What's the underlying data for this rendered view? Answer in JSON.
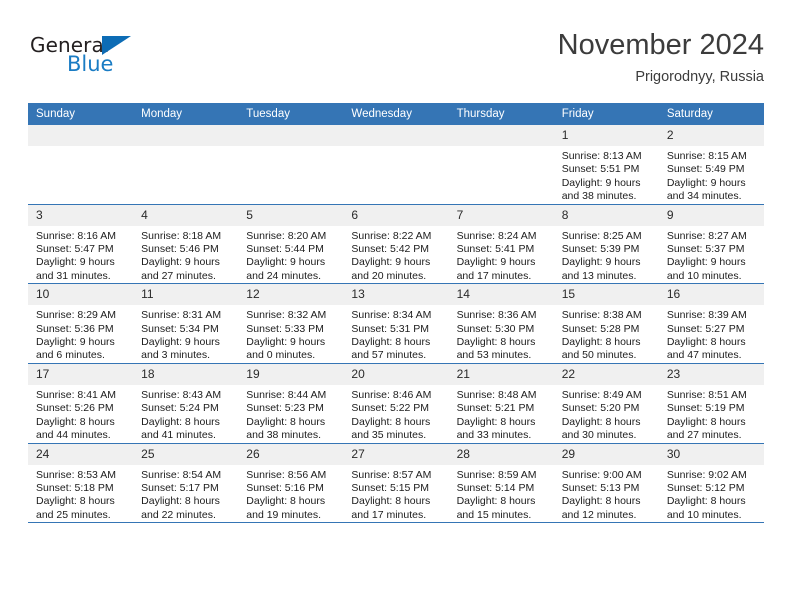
{
  "brand": {
    "word_one": "General",
    "word_two": "Blue",
    "triangle_color": "#0d6cb5",
    "blue_text_color": "#1a7cc4"
  },
  "header": {
    "title": "November 2024",
    "subtitle": "Prigorodnyy, Russia",
    "header_bg": "#3575b5",
    "header_text": "#ffffff"
  },
  "weekday_headers": [
    "Sunday",
    "Monday",
    "Tuesday",
    "Wednesday",
    "Thursday",
    "Friday",
    "Saturday"
  ],
  "labels": {
    "sunrise": "Sunrise:",
    "sunset": "Sunset:",
    "daylight": "Daylight:"
  },
  "weeks": [
    [
      {
        "day": "",
        "empty": true
      },
      {
        "day": "",
        "empty": true
      },
      {
        "day": "",
        "empty": true
      },
      {
        "day": "",
        "empty": true
      },
      {
        "day": "",
        "empty": true
      },
      {
        "day": "1",
        "sunrise": "Sunrise: 8:13 AM",
        "sunset": "Sunset: 5:51 PM",
        "daylight": "Daylight: 9 hours and 38 minutes."
      },
      {
        "day": "2",
        "sunrise": "Sunrise: 8:15 AM",
        "sunset": "Sunset: 5:49 PM",
        "daylight": "Daylight: 9 hours and 34 minutes."
      }
    ],
    [
      {
        "day": "3",
        "sunrise": "Sunrise: 8:16 AM",
        "sunset": "Sunset: 5:47 PM",
        "daylight": "Daylight: 9 hours and 31 minutes."
      },
      {
        "day": "4",
        "sunrise": "Sunrise: 8:18 AM",
        "sunset": "Sunset: 5:46 PM",
        "daylight": "Daylight: 9 hours and 27 minutes."
      },
      {
        "day": "5",
        "sunrise": "Sunrise: 8:20 AM",
        "sunset": "Sunset: 5:44 PM",
        "daylight": "Daylight: 9 hours and 24 minutes."
      },
      {
        "day": "6",
        "sunrise": "Sunrise: 8:22 AM",
        "sunset": "Sunset: 5:42 PM",
        "daylight": "Daylight: 9 hours and 20 minutes."
      },
      {
        "day": "7",
        "sunrise": "Sunrise: 8:24 AM",
        "sunset": "Sunset: 5:41 PM",
        "daylight": "Daylight: 9 hours and 17 minutes."
      },
      {
        "day": "8",
        "sunrise": "Sunrise: 8:25 AM",
        "sunset": "Sunset: 5:39 PM",
        "daylight": "Daylight: 9 hours and 13 minutes."
      },
      {
        "day": "9",
        "sunrise": "Sunrise: 8:27 AM",
        "sunset": "Sunset: 5:37 PM",
        "daylight": "Daylight: 9 hours and 10 minutes."
      }
    ],
    [
      {
        "day": "10",
        "sunrise": "Sunrise: 8:29 AM",
        "sunset": "Sunset: 5:36 PM",
        "daylight": "Daylight: 9 hours and 6 minutes."
      },
      {
        "day": "11",
        "sunrise": "Sunrise: 8:31 AM",
        "sunset": "Sunset: 5:34 PM",
        "daylight": "Daylight: 9 hours and 3 minutes."
      },
      {
        "day": "12",
        "sunrise": "Sunrise: 8:32 AM",
        "sunset": "Sunset: 5:33 PM",
        "daylight": "Daylight: 9 hours and 0 minutes."
      },
      {
        "day": "13",
        "sunrise": "Sunrise: 8:34 AM",
        "sunset": "Sunset: 5:31 PM",
        "daylight": "Daylight: 8 hours and 57 minutes."
      },
      {
        "day": "14",
        "sunrise": "Sunrise: 8:36 AM",
        "sunset": "Sunset: 5:30 PM",
        "daylight": "Daylight: 8 hours and 53 minutes."
      },
      {
        "day": "15",
        "sunrise": "Sunrise: 8:38 AM",
        "sunset": "Sunset: 5:28 PM",
        "daylight": "Daylight: 8 hours and 50 minutes."
      },
      {
        "day": "16",
        "sunrise": "Sunrise: 8:39 AM",
        "sunset": "Sunset: 5:27 PM",
        "daylight": "Daylight: 8 hours and 47 minutes."
      }
    ],
    [
      {
        "day": "17",
        "sunrise": "Sunrise: 8:41 AM",
        "sunset": "Sunset: 5:26 PM",
        "daylight": "Daylight: 8 hours and 44 minutes."
      },
      {
        "day": "18",
        "sunrise": "Sunrise: 8:43 AM",
        "sunset": "Sunset: 5:24 PM",
        "daylight": "Daylight: 8 hours and 41 minutes."
      },
      {
        "day": "19",
        "sunrise": "Sunrise: 8:44 AM",
        "sunset": "Sunset: 5:23 PM",
        "daylight": "Daylight: 8 hours and 38 minutes."
      },
      {
        "day": "20",
        "sunrise": "Sunrise: 8:46 AM",
        "sunset": "Sunset: 5:22 PM",
        "daylight": "Daylight: 8 hours and 35 minutes."
      },
      {
        "day": "21",
        "sunrise": "Sunrise: 8:48 AM",
        "sunset": "Sunset: 5:21 PM",
        "daylight": "Daylight: 8 hours and 33 minutes."
      },
      {
        "day": "22",
        "sunrise": "Sunrise: 8:49 AM",
        "sunset": "Sunset: 5:20 PM",
        "daylight": "Daylight: 8 hours and 30 minutes."
      },
      {
        "day": "23",
        "sunrise": "Sunrise: 8:51 AM",
        "sunset": "Sunset: 5:19 PM",
        "daylight": "Daylight: 8 hours and 27 minutes."
      }
    ],
    [
      {
        "day": "24",
        "sunrise": "Sunrise: 8:53 AM",
        "sunset": "Sunset: 5:18 PM",
        "daylight": "Daylight: 8 hours and 25 minutes."
      },
      {
        "day": "25",
        "sunrise": "Sunrise: 8:54 AM",
        "sunset": "Sunset: 5:17 PM",
        "daylight": "Daylight: 8 hours and 22 minutes."
      },
      {
        "day": "26",
        "sunrise": "Sunrise: 8:56 AM",
        "sunset": "Sunset: 5:16 PM",
        "daylight": "Daylight: 8 hours and 19 minutes."
      },
      {
        "day": "27",
        "sunrise": "Sunrise: 8:57 AM",
        "sunset": "Sunset: 5:15 PM",
        "daylight": "Daylight: 8 hours and 17 minutes."
      },
      {
        "day": "28",
        "sunrise": "Sunrise: 8:59 AM",
        "sunset": "Sunset: 5:14 PM",
        "daylight": "Daylight: 8 hours and 15 minutes."
      },
      {
        "day": "29",
        "sunrise": "Sunrise: 9:00 AM",
        "sunset": "Sunset: 5:13 PM",
        "daylight": "Daylight: 8 hours and 12 minutes."
      },
      {
        "day": "30",
        "sunrise": "Sunrise: 9:02 AM",
        "sunset": "Sunset: 5:12 PM",
        "daylight": "Daylight: 8 hours and 10 minutes."
      }
    ]
  ]
}
